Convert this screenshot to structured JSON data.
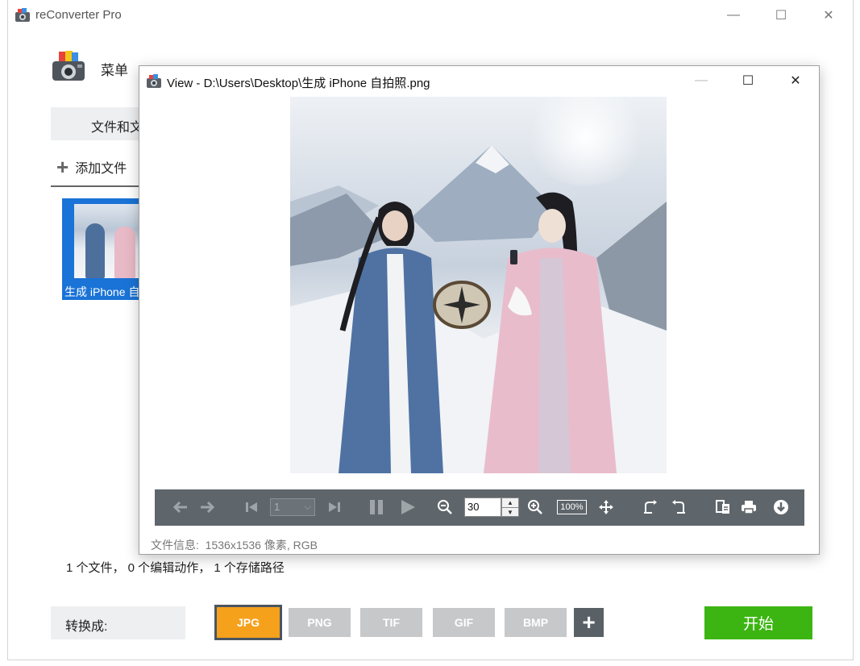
{
  "app": {
    "title": "reConverter Pro",
    "menu_label": "菜单",
    "tab_files": "文件和文",
    "add_files": "添加文件",
    "thumbnail_label": "生成 iPhone 自",
    "status": "1 个文件， 0 个编辑动作， 1 个存储路径",
    "convert_label": "转换成:",
    "formats": [
      "JPG",
      "PNG",
      "TIF",
      "GIF",
      "BMP"
    ],
    "active_format": "JPG",
    "add_format": "+",
    "start": "开始",
    "window_controls": {
      "minimize": "—",
      "maximize": "☐",
      "close": "✕"
    }
  },
  "viewer": {
    "title": "View - D:\\Users\\Desktop\\生成 iPhone 自拍照.png",
    "page_value": "1",
    "zoom_value": "30",
    "zoom_100": "100%",
    "file_info_label": "文件信息:",
    "file_info_value": "1536x1536 像素, RGB",
    "window_controls": {
      "minimize": "—",
      "maximize": "☐",
      "close": "✕"
    }
  },
  "icons": {
    "back": "arrow-left-icon",
    "forward": "arrow-right-icon",
    "first": "skip-first-icon",
    "last": "skip-last-icon",
    "pause": "pause-icon",
    "play": "play-icon",
    "zoom_out": "zoom-out-icon",
    "zoom_in": "zoom-in-icon",
    "fit": "move-icon",
    "rotate_left": "rotate-left-icon",
    "rotate_right": "rotate-right-icon",
    "info": "properties-icon",
    "print": "print-icon",
    "save": "download-icon"
  },
  "colors": {
    "active_format": "#f5a11c",
    "inactive_format": "#c7c8ca",
    "start": "#3cb512",
    "selection": "#1a73d6",
    "toolbar": "#5f666b"
  }
}
